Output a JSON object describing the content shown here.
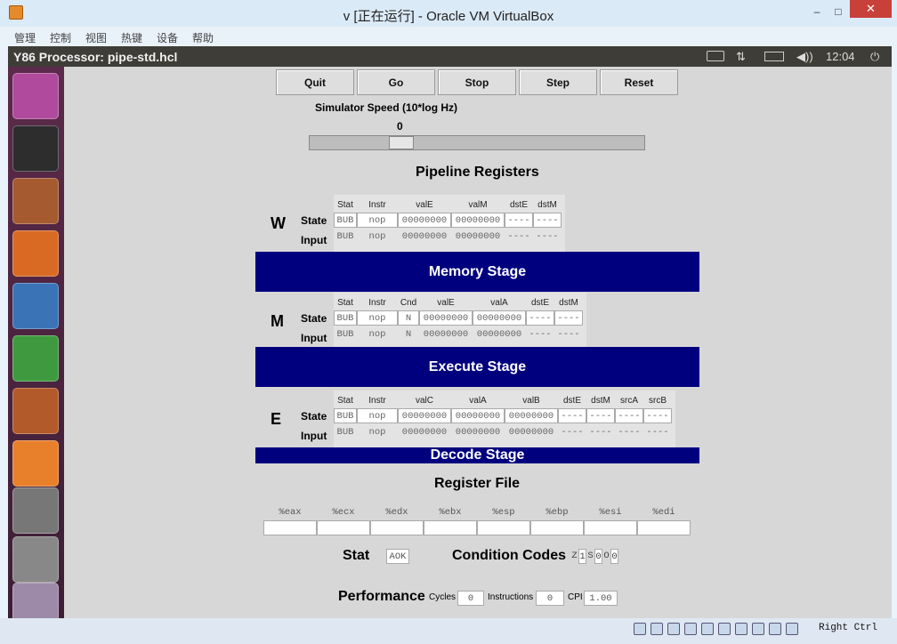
{
  "window": {
    "title": "v [正在运行] - Oracle VM VirtualBox",
    "minimize": "–",
    "maximize": "□",
    "close": "✕"
  },
  "menu": [
    "管理",
    "控制",
    "视图",
    "热键",
    "设备",
    "帮助"
  ],
  "ubuntu_panel": {
    "window_title": "Y86 Processor: pipe-std.hcl",
    "time": "12:04",
    "indicators": [
      "keyboard-icon",
      "network-icon",
      "battery-icon",
      "volume-icon",
      "power-icon"
    ]
  },
  "launcher": [
    "ubuntu-dash-icon",
    "terminal-icon",
    "files-icon",
    "firefox-icon",
    "writer-icon",
    "calc-icon",
    "impress-icon",
    "software-center-icon",
    "settings-icon",
    "help-icon",
    "disc-icon"
  ],
  "controls": {
    "quit": "Quit",
    "go": "Go",
    "stop": "Stop",
    "step": "Step",
    "reset": "Reset"
  },
  "speed": {
    "label": "Simulator Speed (10*log Hz)",
    "value": "0",
    "fraction": 0.27
  },
  "pipeline_title": "Pipeline Registers",
  "w": {
    "label": "W",
    "state_label": "State",
    "input_label": "Input",
    "headers": [
      "Stat",
      "Instr",
      "valE",
      "valM",
      "dstE",
      "dstM"
    ],
    "state": [
      "BUB",
      "nop",
      "00000000",
      "00000000",
      "----",
      "----"
    ],
    "input": [
      "BUB",
      "nop",
      "00000000",
      "00000000",
      "----",
      "----"
    ]
  },
  "memory_stage": "Memory Stage",
  "m": {
    "label": "M",
    "state_label": "State",
    "input_label": "Input",
    "headers": [
      "Stat",
      "Instr",
      "Cnd",
      "valE",
      "valA",
      "dstE",
      "dstM"
    ],
    "state": [
      "BUB",
      "nop",
      "N",
      "00000000",
      "00000000",
      "----",
      "----"
    ],
    "input": [
      "BUB",
      "nop",
      "N",
      "00000000",
      "00000000",
      "----",
      "----"
    ]
  },
  "execute_stage": "Execute Stage",
  "e": {
    "label": "E",
    "state_label": "State",
    "input_label": "Input",
    "headers": [
      "Stat",
      "Instr",
      "valC",
      "valA",
      "valB",
      "dstE",
      "dstM",
      "srcA",
      "srcB"
    ],
    "state": [
      "BUB",
      "nop",
      "00000000",
      "00000000",
      "00000000",
      "----",
      "----",
      "----",
      "----"
    ],
    "input": [
      "BUB",
      "nop",
      "00000000",
      "00000000",
      "00000000",
      "----",
      "----",
      "----",
      "----"
    ]
  },
  "decode_stage": "Decode Stage",
  "register_file": {
    "title": "Register File",
    "names": [
      "%eax",
      "%ecx",
      "%edx",
      "%ebx",
      "%esp",
      "%ebp",
      "%esi",
      "%edi"
    ]
  },
  "status": {
    "stat_label": "Stat",
    "stat_value": "AOK",
    "cc_label": "Condition Codes",
    "cc": [
      "Z",
      "1",
      "S",
      "0",
      "O",
      "0"
    ]
  },
  "performance": {
    "label": "Performance",
    "cycles_label": "Cycles",
    "cycles": "0",
    "instr_label": "Instructions",
    "instr": "0",
    "cpi_label": "CPI",
    "cpi": "1.00"
  },
  "statusbar": {
    "host_key": "Right Ctrl"
  }
}
